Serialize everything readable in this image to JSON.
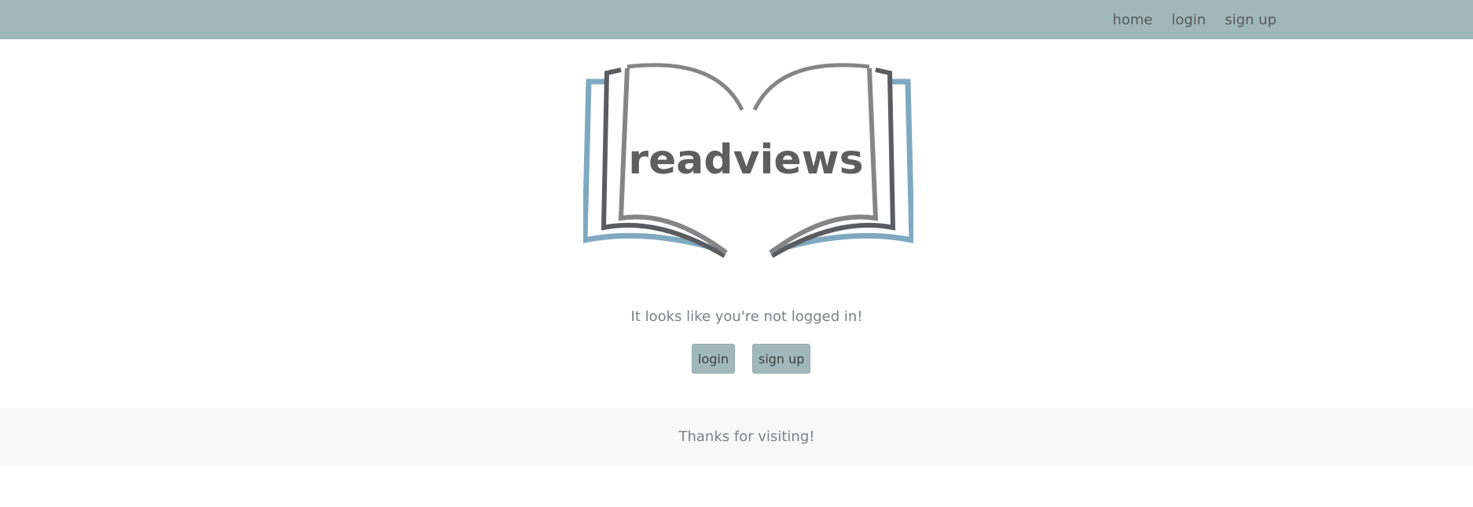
{
  "nav": {
    "links": [
      "home",
      "login",
      "sign up"
    ]
  },
  "logo": {
    "text": "readviews",
    "colors": {
      "blue": "#7fa9c0",
      "dark_gray": "#5b5c5f",
      "light_gray": "#858585"
    }
  },
  "main": {
    "message": "It looks like you're not logged in!",
    "login_label": "login",
    "signup_label": "sign up"
  },
  "footer": {
    "text": "Thanks for visiting!"
  },
  "colors": {
    "navbar": "#a1b8bb",
    "button": "#a1b8bb",
    "footer": "#f8f8f8",
    "text": "#7d8284"
  }
}
